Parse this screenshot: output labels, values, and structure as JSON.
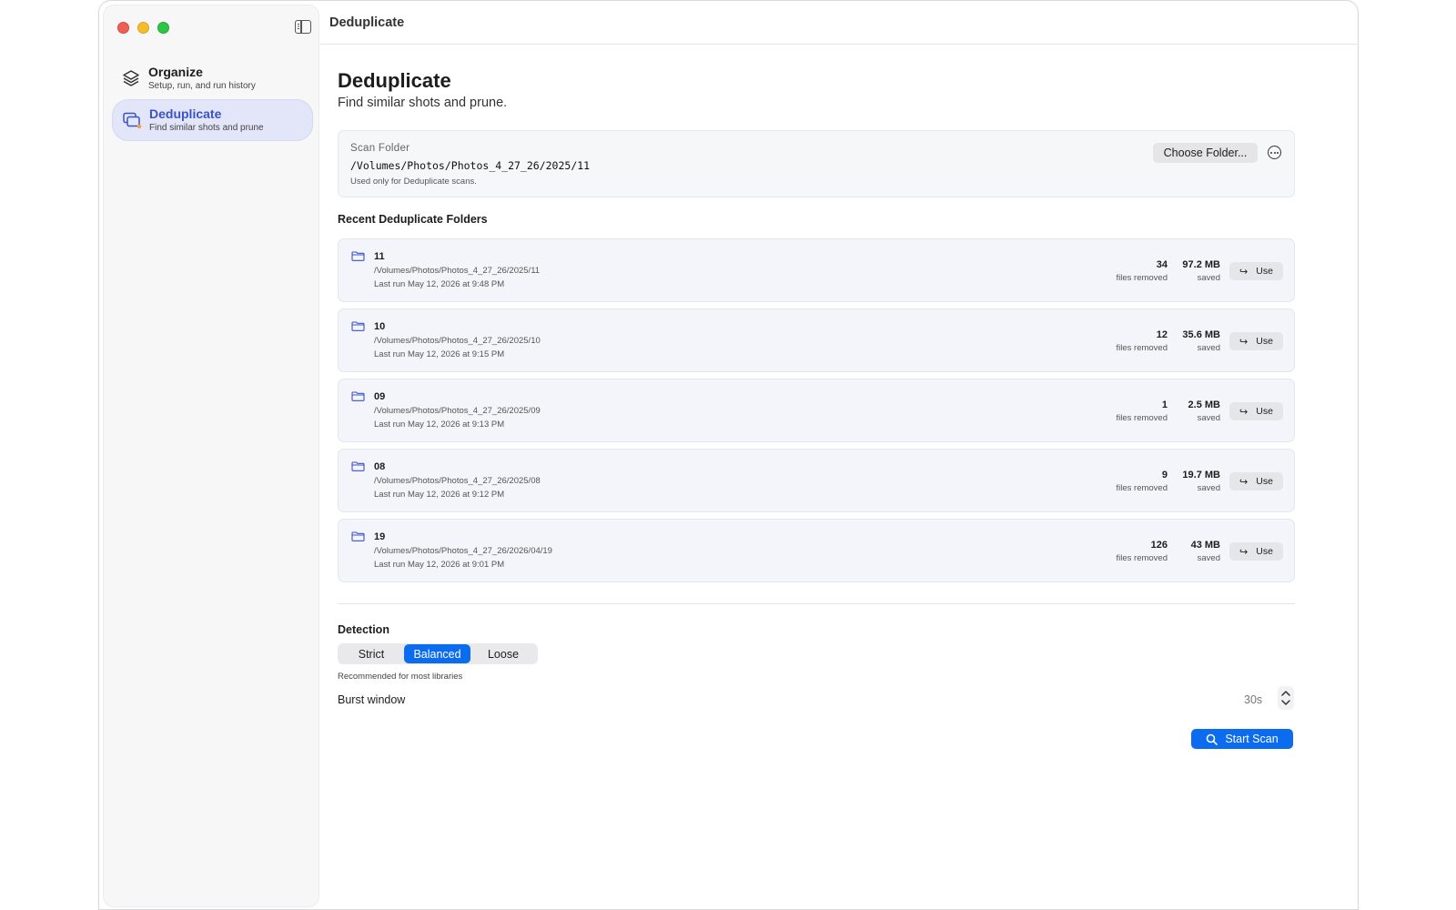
{
  "window": {
    "title": "Deduplicate"
  },
  "sidebar": {
    "items": [
      {
        "title": "Organize",
        "subtitle": "Setup, run, and run history",
        "icon": "stack-layers-icon"
      },
      {
        "title": "Deduplicate",
        "subtitle": "Find similar shots and prune",
        "icon": "duplicate-photos-icon"
      }
    ]
  },
  "header": {
    "title": "Deduplicate",
    "subtitle": "Find similar shots and prune."
  },
  "scan_folder": {
    "label": "Scan Folder",
    "path": "/Volumes/Photos/Photos_4_27_26/2025/11",
    "note": "Used only for Deduplicate scans.",
    "choose_label": "Choose Folder..."
  },
  "recent": {
    "heading": "Recent Deduplicate Folders",
    "rows": [
      {
        "name": "11",
        "path": "/Volumes/Photos/Photos_4_27_26/2025/11",
        "last_run": "Last run May 12, 2026 at 9:48 PM",
        "files": "34",
        "files_label": "files removed",
        "saved": "97.2 MB",
        "saved_label": "saved",
        "use_label": "Use"
      },
      {
        "name": "10",
        "path": "/Volumes/Photos/Photos_4_27_26/2025/10",
        "last_run": "Last run May 12, 2026 at 9:15 PM",
        "files": "12",
        "files_label": "files removed",
        "saved": "35.6 MB",
        "saved_label": "saved",
        "use_label": "Use"
      },
      {
        "name": "09",
        "path": "/Volumes/Photos/Photos_4_27_26/2025/09",
        "last_run": "Last run May 12, 2026 at 9:13 PM",
        "files": "1",
        "files_label": "files removed",
        "saved": "2.5 MB",
        "saved_label": "saved",
        "use_label": "Use"
      },
      {
        "name": "08",
        "path": "/Volumes/Photos/Photos_4_27_26/2025/08",
        "last_run": "Last run May 12, 2026 at 9:12 PM",
        "files": "9",
        "files_label": "files removed",
        "saved": "19.7 MB",
        "saved_label": "saved",
        "use_label": "Use"
      },
      {
        "name": "19",
        "path": "/Volumes/Photos/Photos_4_27_26/2026/04/19",
        "last_run": "Last run May 12, 2026 at 9:01 PM",
        "files": "126",
        "files_label": "files removed",
        "saved": "43 MB",
        "saved_label": "saved",
        "use_label": "Use"
      }
    ]
  },
  "detection": {
    "heading": "Detection",
    "options": [
      "Strict",
      "Balanced",
      "Loose"
    ],
    "selected": "Balanced",
    "note": "Recommended for most libraries",
    "burst_label": "Burst window",
    "burst_value": "30s",
    "start_label": "Start Scan"
  },
  "colors": {
    "accent": "#0b6cf0",
    "sidebar_active": "#e3e6f8",
    "row_bg": "#f3f5fa"
  }
}
